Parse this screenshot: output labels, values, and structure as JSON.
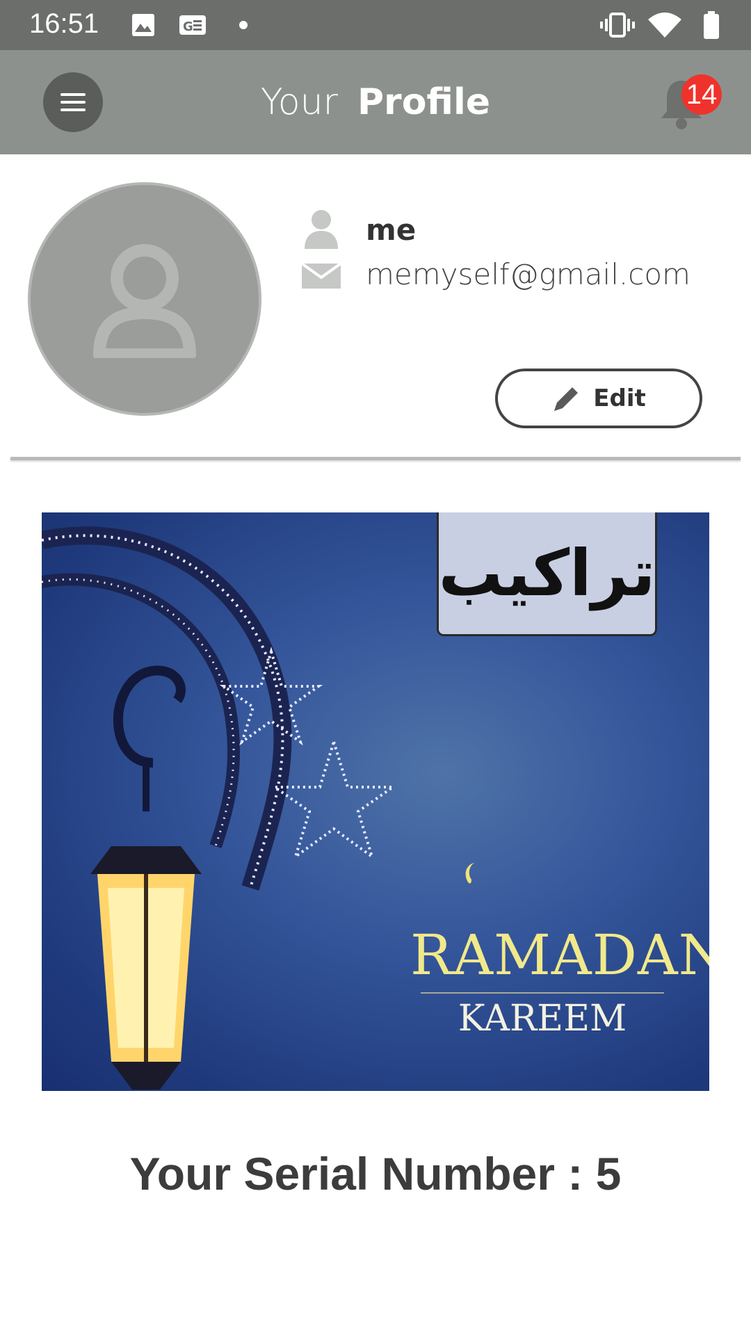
{
  "status_bar": {
    "time": "16:51",
    "icons": [
      "image-icon",
      "ge-icon",
      "dot-icon",
      "vibrate-icon",
      "wifi-icon",
      "battery-icon"
    ]
  },
  "app_bar": {
    "title_light": "Your",
    "title_bold": "Profile",
    "notification_count": "14",
    "icons": [
      "menu-icon",
      "bell-icon"
    ]
  },
  "profile": {
    "name": "me",
    "email": "memyself@gmail.com",
    "edit_label": "Edit"
  },
  "banner": {
    "logo_text": "تراكيب",
    "title": "RAMADAN",
    "subtitle": "KAREEM"
  },
  "serial": {
    "text": "Your Serial Number : 5"
  },
  "colors": {
    "status_bar": "#6b6e6b",
    "app_bar": "#8d918d",
    "badge": "#f0322c",
    "avatar": "#9a9d9a"
  }
}
